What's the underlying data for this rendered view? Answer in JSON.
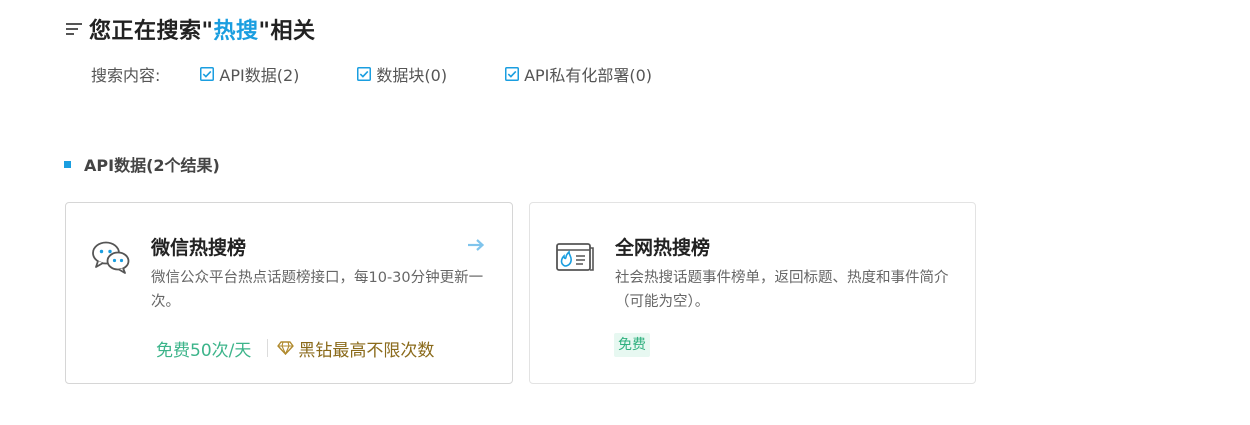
{
  "header": {
    "title_prefix": "您正在搜索\"",
    "keyword": "热搜",
    "title_suffix": "\"相关"
  },
  "filters": {
    "label": "搜索内容:",
    "options": [
      {
        "label": "API数据(2)",
        "checked": true
      },
      {
        "label": "数据块(0)",
        "checked": true
      },
      {
        "label": "API私有化部署(0)",
        "checked": true
      }
    ]
  },
  "section": {
    "title": "API数据(2个结果)"
  },
  "cards": [
    {
      "icon": "wechat-chat-icon",
      "title": "微信热搜榜",
      "description": "微信公众平台热点话题榜接口，每10-30分钟更新一次。",
      "free_quota": "免费50次/天",
      "vip_text": "黑钻最高不限次数"
    },
    {
      "icon": "hot-news-icon",
      "title": "全网热搜榜",
      "description": "社会热搜话题事件榜单，返回标题、热度和事件简介（可能为空）。",
      "badge": "免费"
    }
  ],
  "colors": {
    "accent": "#1a9ee0",
    "free_green": "#3cb48a",
    "vip_gold": "#8a6a1a"
  }
}
